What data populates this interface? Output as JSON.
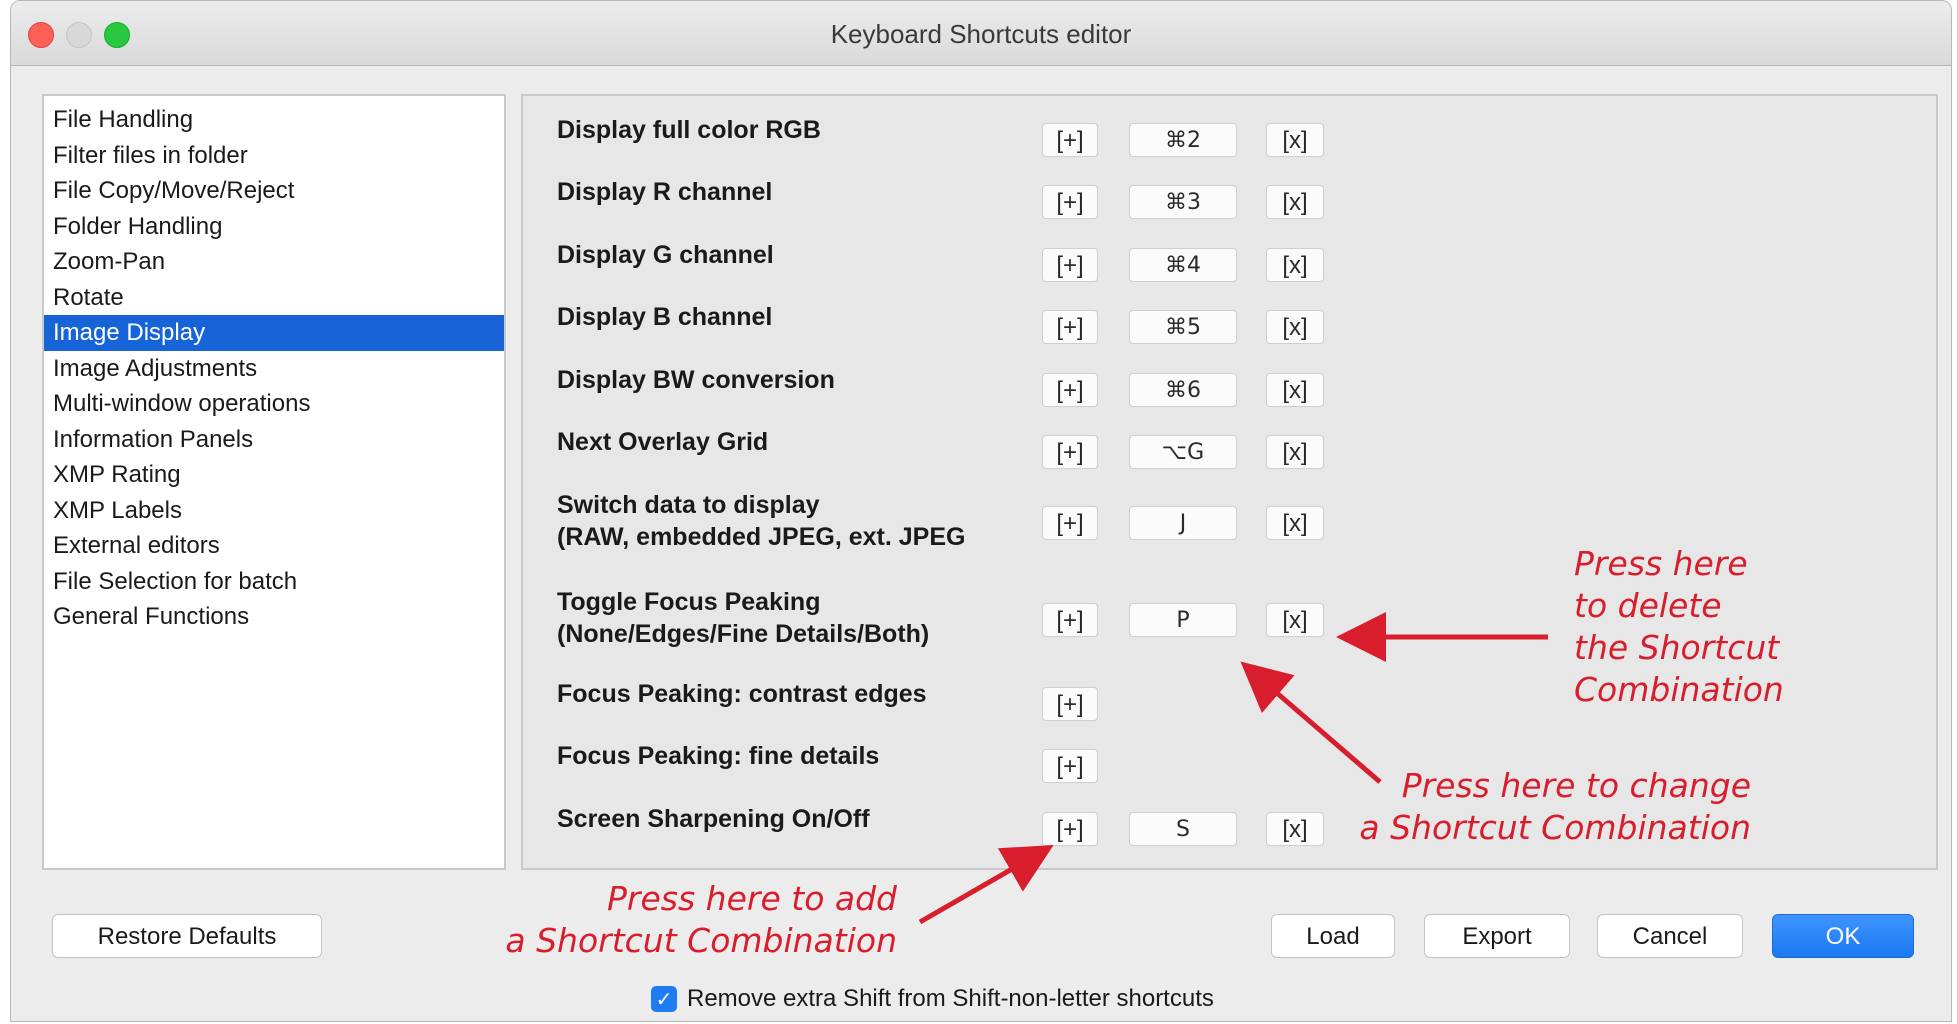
{
  "window": {
    "title": "Keyboard Shortcuts editor"
  },
  "categories": [
    {
      "label": "File Handling",
      "selected": false
    },
    {
      "label": "Filter files in folder",
      "selected": false
    },
    {
      "label": "File Copy/Move/Reject",
      "selected": false
    },
    {
      "label": "Folder Handling",
      "selected": false
    },
    {
      "label": "Zoom-Pan",
      "selected": false
    },
    {
      "label": "Rotate",
      "selected": false
    },
    {
      "label": "Image Display",
      "selected": true
    },
    {
      "label": "Image Adjustments",
      "selected": false
    },
    {
      "label": "Multi-window operations",
      "selected": false
    },
    {
      "label": "Information Panels",
      "selected": false
    },
    {
      "label": "XMP Rating",
      "selected": false
    },
    {
      "label": "XMP Labels",
      "selected": false
    },
    {
      "label": "External editors",
      "selected": false
    },
    {
      "label": "File Selection for batch",
      "selected": false
    },
    {
      "label": "General Functions",
      "selected": false
    }
  ],
  "shortcut_buttons": {
    "add": "[+]",
    "delete": "[x]"
  },
  "shortcuts": [
    {
      "label_lines": [
        "Display full color RGB"
      ],
      "key": "⌘2"
    },
    {
      "label_lines": [
        "Display R channel"
      ],
      "key": "⌘3"
    },
    {
      "label_lines": [
        "Display G channel"
      ],
      "key": "⌘4"
    },
    {
      "label_lines": [
        "Display B channel"
      ],
      "key": "⌘5"
    },
    {
      "label_lines": [
        "Display BW conversion"
      ],
      "key": "⌘6"
    },
    {
      "label_lines": [
        "Next Overlay Grid"
      ],
      "key": "⌥G"
    },
    {
      "label_lines": [
        "Switch data to display",
        "(RAW, embedded JPEG, ext. JPEG"
      ],
      "key": "J"
    },
    {
      "label_lines": [
        "Toggle Focus Peaking",
        "(None/Edges/Fine Details/Both)"
      ],
      "key": "P"
    },
    {
      "label_lines": [
        "Focus Peaking: contrast edges"
      ],
      "key": null
    },
    {
      "label_lines": [
        "Focus Peaking: fine details"
      ],
      "key": null
    },
    {
      "label_lines": [
        "Screen Sharpening On/Off"
      ],
      "key": "S"
    }
  ],
  "bottom_buttons": {
    "restore_defaults": "Restore Defaults",
    "load": "Load",
    "export": "Export",
    "cancel": "Cancel",
    "ok": "OK"
  },
  "checkbox": {
    "label": "Remove extra Shift from Shift-non-letter shortcuts",
    "checked": true
  },
  "annotations": {
    "delete": [
      "Press here",
      "to delete",
      "the Shortcut",
      "Combination"
    ],
    "change": [
      "Press here to change",
      "a Shortcut Combination"
    ],
    "add": [
      "Press here to add",
      "a Shortcut Combination"
    ]
  },
  "colors": {
    "accent": "#1664d8",
    "annotation": "#d81e2c",
    "ok_button": "#1a78f2"
  }
}
